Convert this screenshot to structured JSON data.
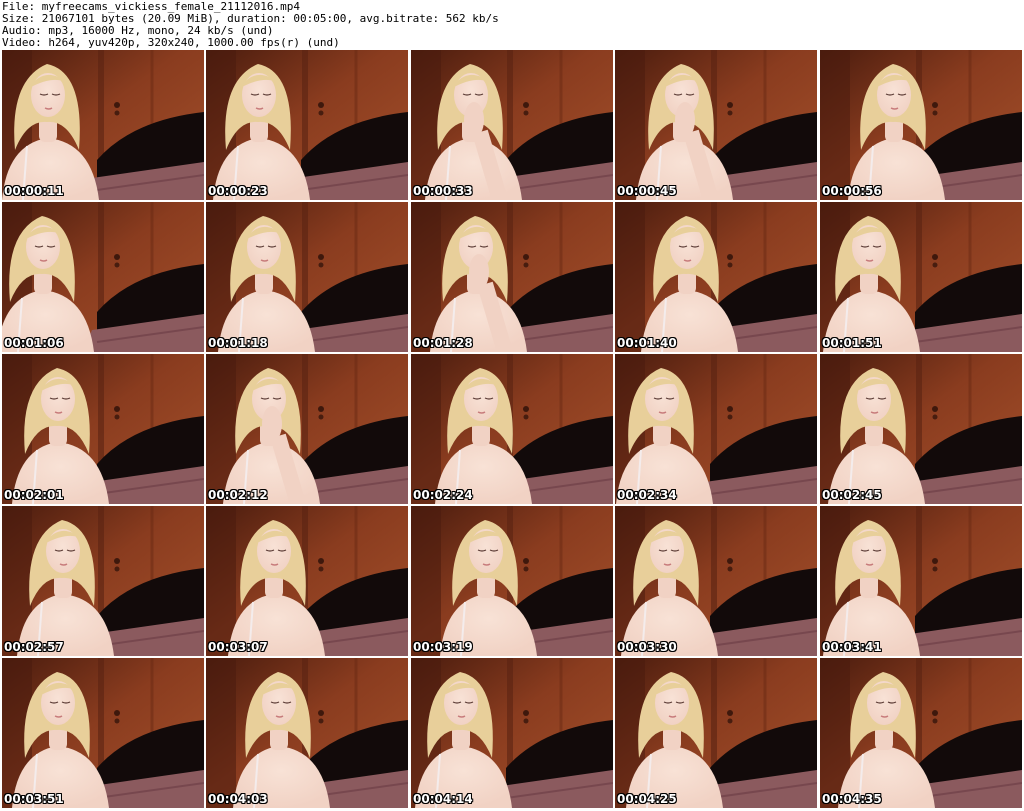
{
  "header": {
    "file_line": "File: myfreecams_vickiess_female_21112016.mp4",
    "size_line": "Size: 21067101 bytes (20.09 MiB), duration: 00:05:00, avg.bitrate: 562 kb/s",
    "audio_line": "Audio: mp3, 16000 Hz, mono, 24 kb/s (und)",
    "video_line": "Video: h264, yuv420p, 320x240, 1000.00 fps(r) (und)"
  },
  "thumbnails": [
    {
      "timestamp": "00:00:11"
    },
    {
      "timestamp": "00:00:23"
    },
    {
      "timestamp": "00:00:33"
    },
    {
      "timestamp": "00:00:45"
    },
    {
      "timestamp": "00:00:56"
    },
    {
      "timestamp": "00:01:06"
    },
    {
      "timestamp": "00:01:18"
    },
    {
      "timestamp": "00:01:28"
    },
    {
      "timestamp": "00:01:40"
    },
    {
      "timestamp": "00:01:51"
    },
    {
      "timestamp": "00:02:01"
    },
    {
      "timestamp": "00:02:12"
    },
    {
      "timestamp": "00:02:24"
    },
    {
      "timestamp": "00:02:34"
    },
    {
      "timestamp": "00:02:45"
    },
    {
      "timestamp": "00:02:57"
    },
    {
      "timestamp": "00:03:07"
    },
    {
      "timestamp": "00:03:19"
    },
    {
      "timestamp": "00:03:30"
    },
    {
      "timestamp": "00:03:41"
    },
    {
      "timestamp": "00:03:51"
    },
    {
      "timestamp": "00:04:03"
    },
    {
      "timestamp": "00:04:14"
    },
    {
      "timestamp": "00:04:25"
    },
    {
      "timestamp": "00:04:35"
    }
  ],
  "colors": {
    "wall": "#8a3c1f",
    "wall_dark": "#4a1c0e",
    "headboard": "#120a0a",
    "bedspread": "#8b5a5e",
    "hair": "#e8cf9a",
    "skin": "#f1d2c4"
  }
}
